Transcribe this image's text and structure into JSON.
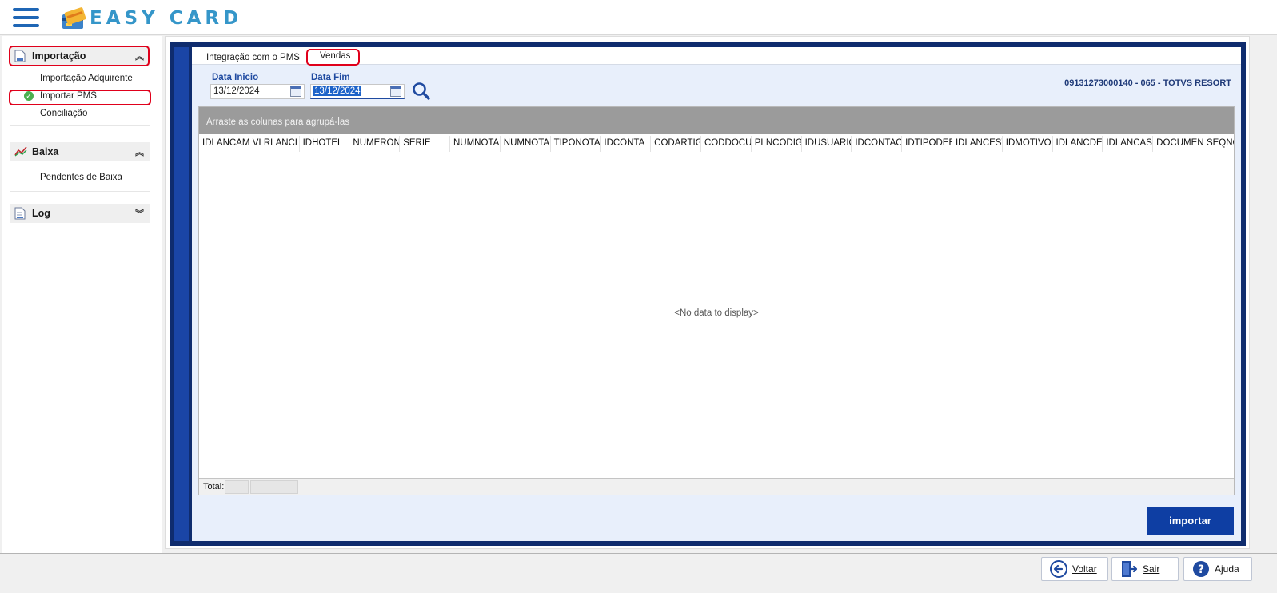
{
  "app": {
    "logo_text": "EASY CARD"
  },
  "sidebar": {
    "groups": [
      {
        "label": "Importação",
        "items": [
          "Importação Adquirente",
          "Importar PMS",
          "Conciliação"
        ]
      },
      {
        "label": "Baixa",
        "items": [
          "Pendentes de Baixa"
        ]
      },
      {
        "label": "Log",
        "items": []
      }
    ]
  },
  "tabs": [
    "Integração com o PMS",
    "Vendas"
  ],
  "filters": {
    "data_inicio_label": "Data Inicio",
    "data_inicio_value": "13/12/2024",
    "data_fim_label": "Data Fim",
    "data_fim_value": "13/12/2024"
  },
  "company": "09131273000140 - 065 - TOTVS RESORT",
  "grid": {
    "group_panel_text": "Arraste as colunas para agrupá-las",
    "columns": [
      "IDLANCAME",
      "VLRLANCLIC",
      "IDHOTEL",
      "NUMERON(",
      "SERIE",
      "NUMNOTAF",
      "NUMNOTA",
      "TIPONOTA",
      "IDCONTA",
      "CODARTIGC",
      "CODDOCUI",
      "PLNCODIGC",
      "IDUSUARIO",
      "IDCONTAOF",
      "IDTIPODEB(",
      "IDLANCEST(",
      "IDMOTIVOE",
      "IDLANCDES",
      "IDLANCASS",
      "DOCUMENT",
      "SEQNO"
    ],
    "empty_text": "<No data to display>",
    "total_label": "Total:"
  },
  "buttons": {
    "importar": "importar",
    "voltar": "Voltar",
    "sair": "Sair",
    "ajuda": "Ajuda"
  },
  "colors": {
    "brand_blue": "#1f66b5",
    "frame_navy": "#0f2c6e",
    "highlight_red": "#e0001b",
    "importar_blue": "#0e3ea3"
  }
}
